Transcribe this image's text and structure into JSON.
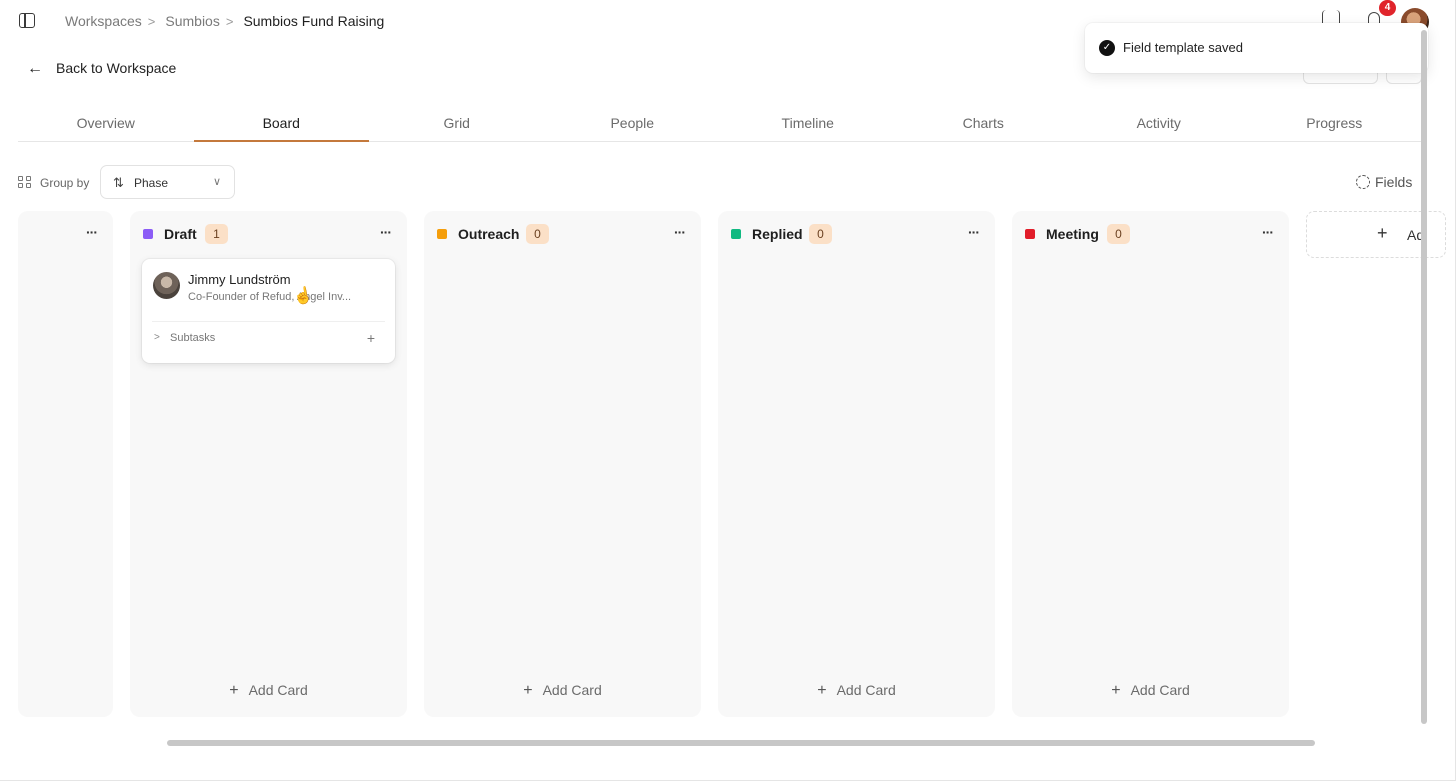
{
  "breadcrumb": {
    "items": [
      "Workspaces",
      "Sumbios"
    ],
    "current": "Sumbios Fund Raising"
  },
  "notifications": {
    "count": "4"
  },
  "back": {
    "label": "Back to Workspace"
  },
  "toast": {
    "message": "Field template saved"
  },
  "tabs": [
    "Overview",
    "Board",
    "Grid",
    "People",
    "Timeline",
    "Charts",
    "Activity",
    "Progress"
  ],
  "active_tab": "Board",
  "toolbar": {
    "group_by_label": "Group by",
    "group_by_value": "Phase",
    "fields_label": "Fields"
  },
  "columns": [
    {
      "name": "Draft",
      "count": "1",
      "color": "#8b5cf6",
      "add_label": "Add Card"
    },
    {
      "name": "Outreach",
      "count": "0",
      "color": "#f59e0b",
      "add_label": "Add Card"
    },
    {
      "name": "Replied",
      "count": "0",
      "color": "#10b981",
      "add_label": "Add Card"
    },
    {
      "name": "Meeting",
      "count": "0",
      "color": "#e11d2a",
      "add_label": "Add Card"
    }
  ],
  "more_label": "···",
  "add_column_label": "Ad",
  "card": {
    "name": "Jimmy Lundström",
    "subtitle": "Co-Founder of Refu",
    "subtitle_rest": "d, Angel Inv...",
    "subtasks_label": "Subtasks"
  },
  "colors": {
    "accent": "#c4793c",
    "count_badge": "#fbe0c7",
    "notif_badge": "#e0242b"
  }
}
